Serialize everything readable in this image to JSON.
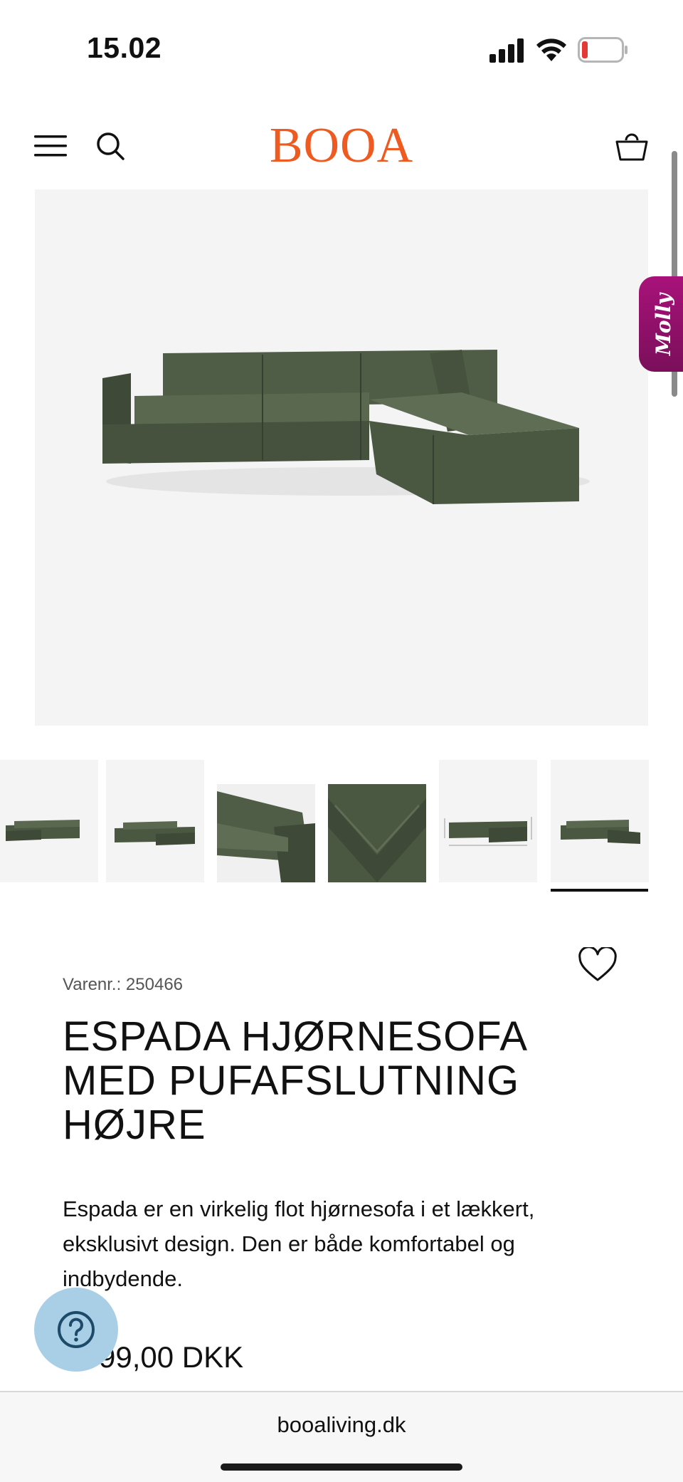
{
  "status_bar": {
    "time": "15.02",
    "icons": [
      "signal-icon",
      "wifi-icon",
      "battery-low-icon"
    ],
    "battery_color": "#e53935"
  },
  "header": {
    "logo": "BOOA",
    "logo_color": "#ee5a1f",
    "icons": [
      "menu-icon",
      "search-icon",
      "cart-icon"
    ]
  },
  "chat_widget": {
    "label": "Molly",
    "color": "#a8127a"
  },
  "gallery": {
    "thumbnail_count": 6,
    "active_index": 5
  },
  "product": {
    "sku_text": "Varenr.: 250466",
    "title": "ESPADA HJØRNESOFA MED PUFAFSLUTNING HØJRE",
    "description": "Espada er en virkelig flot hjørnesofa i et lækkert, eksklusivt design. Den er både komfortabel og indbydende.",
    "price_visible": ".999,00 DKK",
    "sofa_color": "#4a5741"
  },
  "help": {
    "icon": "help-icon",
    "color": "#a9cfe6"
  },
  "browser": {
    "url": "booaliving.dk"
  }
}
